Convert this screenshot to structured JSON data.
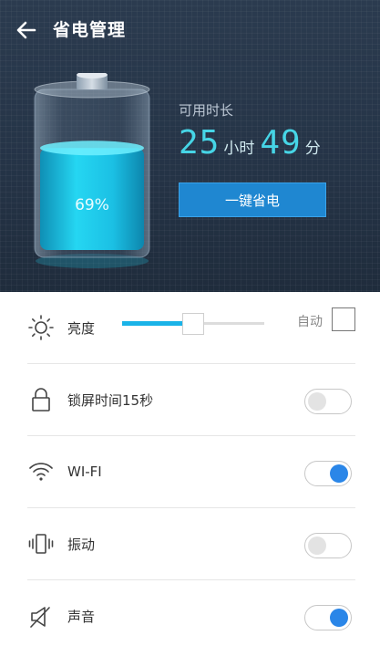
{
  "header": {
    "title": "省电管理"
  },
  "battery": {
    "percent_text": "69%",
    "level": 0.69
  },
  "usage": {
    "label": "可用时长",
    "hours": "25",
    "hours_unit": "小时",
    "minutes": "49",
    "minutes_unit": "分",
    "save_button": "一键省电"
  },
  "settings": {
    "brightness": {
      "label": "亮度",
      "level": 0.5,
      "auto_label": "自动",
      "auto_checked": false
    },
    "lock": {
      "label": "锁屏时间15秒",
      "on": false
    },
    "wifi": {
      "label": "WI-FI",
      "on": true
    },
    "vibration": {
      "label": "振动",
      "on": false
    },
    "sound": {
      "label": "声音",
      "on": true
    }
  },
  "colors": {
    "accent": "#2a86e8",
    "button": "#1f87d1",
    "battery": "#1ec7e4",
    "digits": "#46d5e6"
  }
}
